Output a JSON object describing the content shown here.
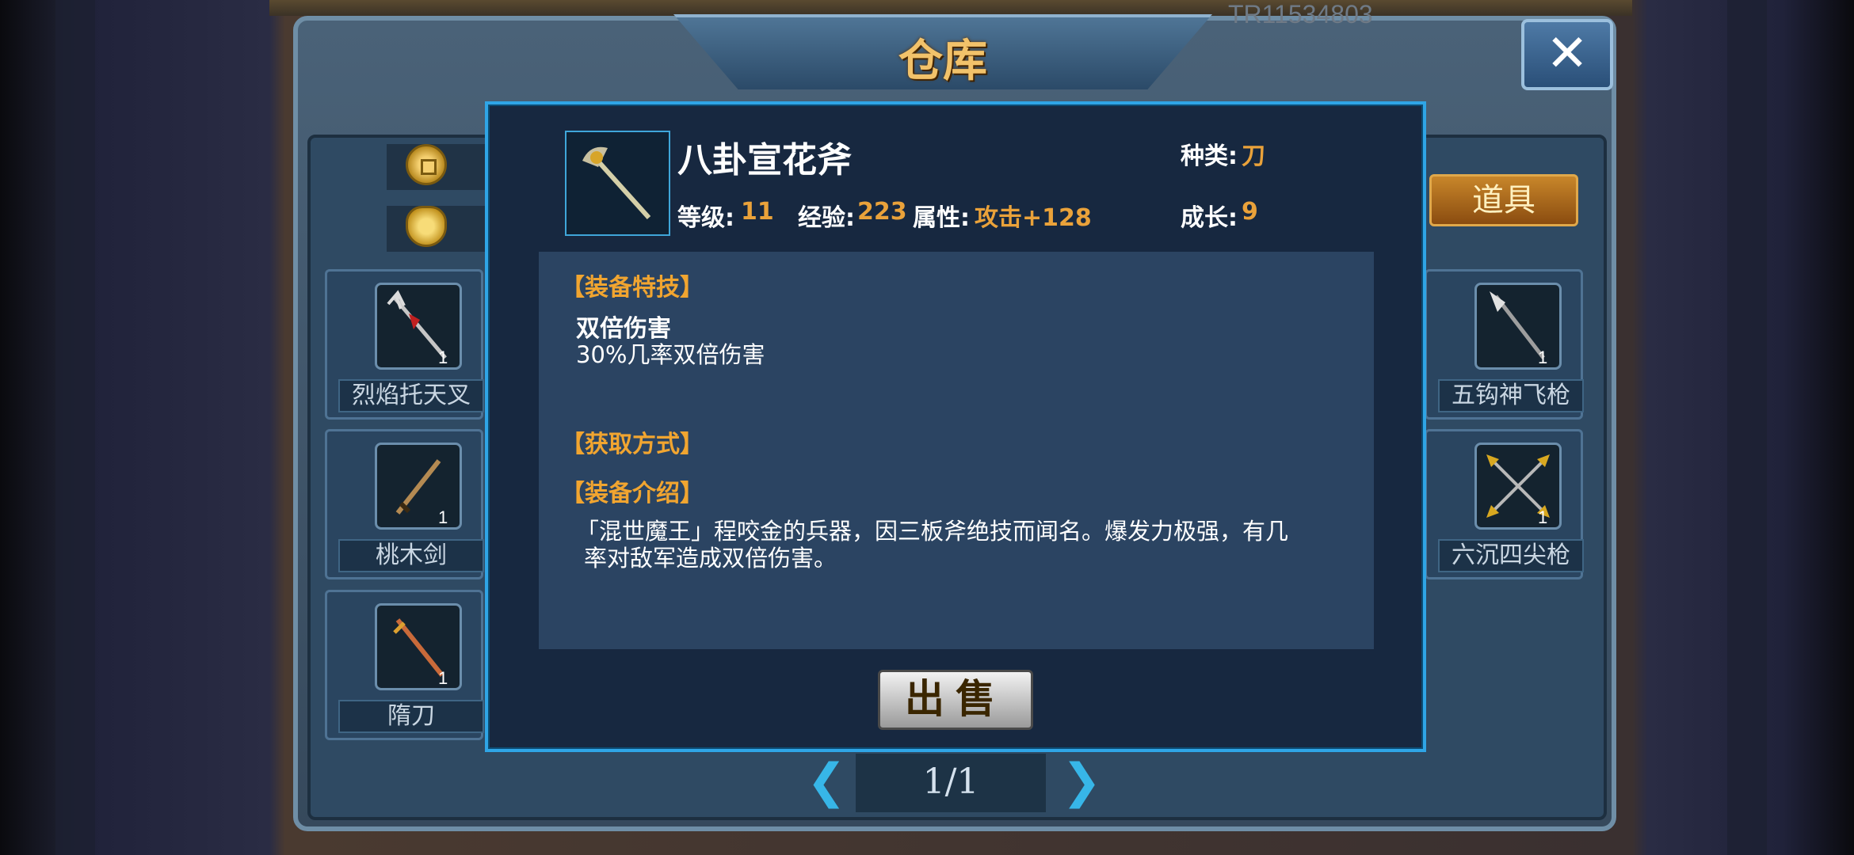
{
  "header": {
    "title": "仓库",
    "id_text": "TR11534803"
  },
  "tabs": {
    "items_label": "道具"
  },
  "inventory": {
    "left": [
      {
        "name": "烈焰托天叉",
        "qty": "1",
        "icon": "trident-icon"
      },
      {
        "name": "桃木剑",
        "qty": "1",
        "icon": "sword-icon"
      },
      {
        "name": "隋刀",
        "qty": "1",
        "icon": "saber-icon"
      }
    ],
    "right": [
      {
        "name": "五钩神飞枪",
        "qty": "1",
        "icon": "spear-icon"
      },
      {
        "name": "六沉四尖枪",
        "qty": "1",
        "icon": "crossed-spears-icon"
      }
    ]
  },
  "pagination": {
    "text": "1/1"
  },
  "detail": {
    "name": "八卦宣花斧",
    "icon": "axe-icon",
    "type_label": "种类:",
    "type_value": "刀",
    "level_label": "等级:",
    "level_value": "11",
    "exp_label": "经验:",
    "exp_value": "223",
    "attr_label": "属性:",
    "attr_value": "攻击+128",
    "growth_label": "成长:",
    "growth_value": "9",
    "skill_header": "【装备特技】",
    "skill_name": "双倍伤害",
    "skill_desc": "30%几率双倍伤害",
    "obtain_header": "【获取方式】",
    "intro_header": "【装备介绍】",
    "intro_line1": "「混世魔王」程咬金的兵器，因三板斧绝技而闻名。爆发力极强，有几",
    "intro_line2": "率对敌军造成双倍伤害。",
    "sell_label": "出售"
  },
  "colors": {
    "accent_orange": "#eaa23a",
    "popup_border": "#2fa5e6",
    "panel_blue": "#2f4a63"
  }
}
